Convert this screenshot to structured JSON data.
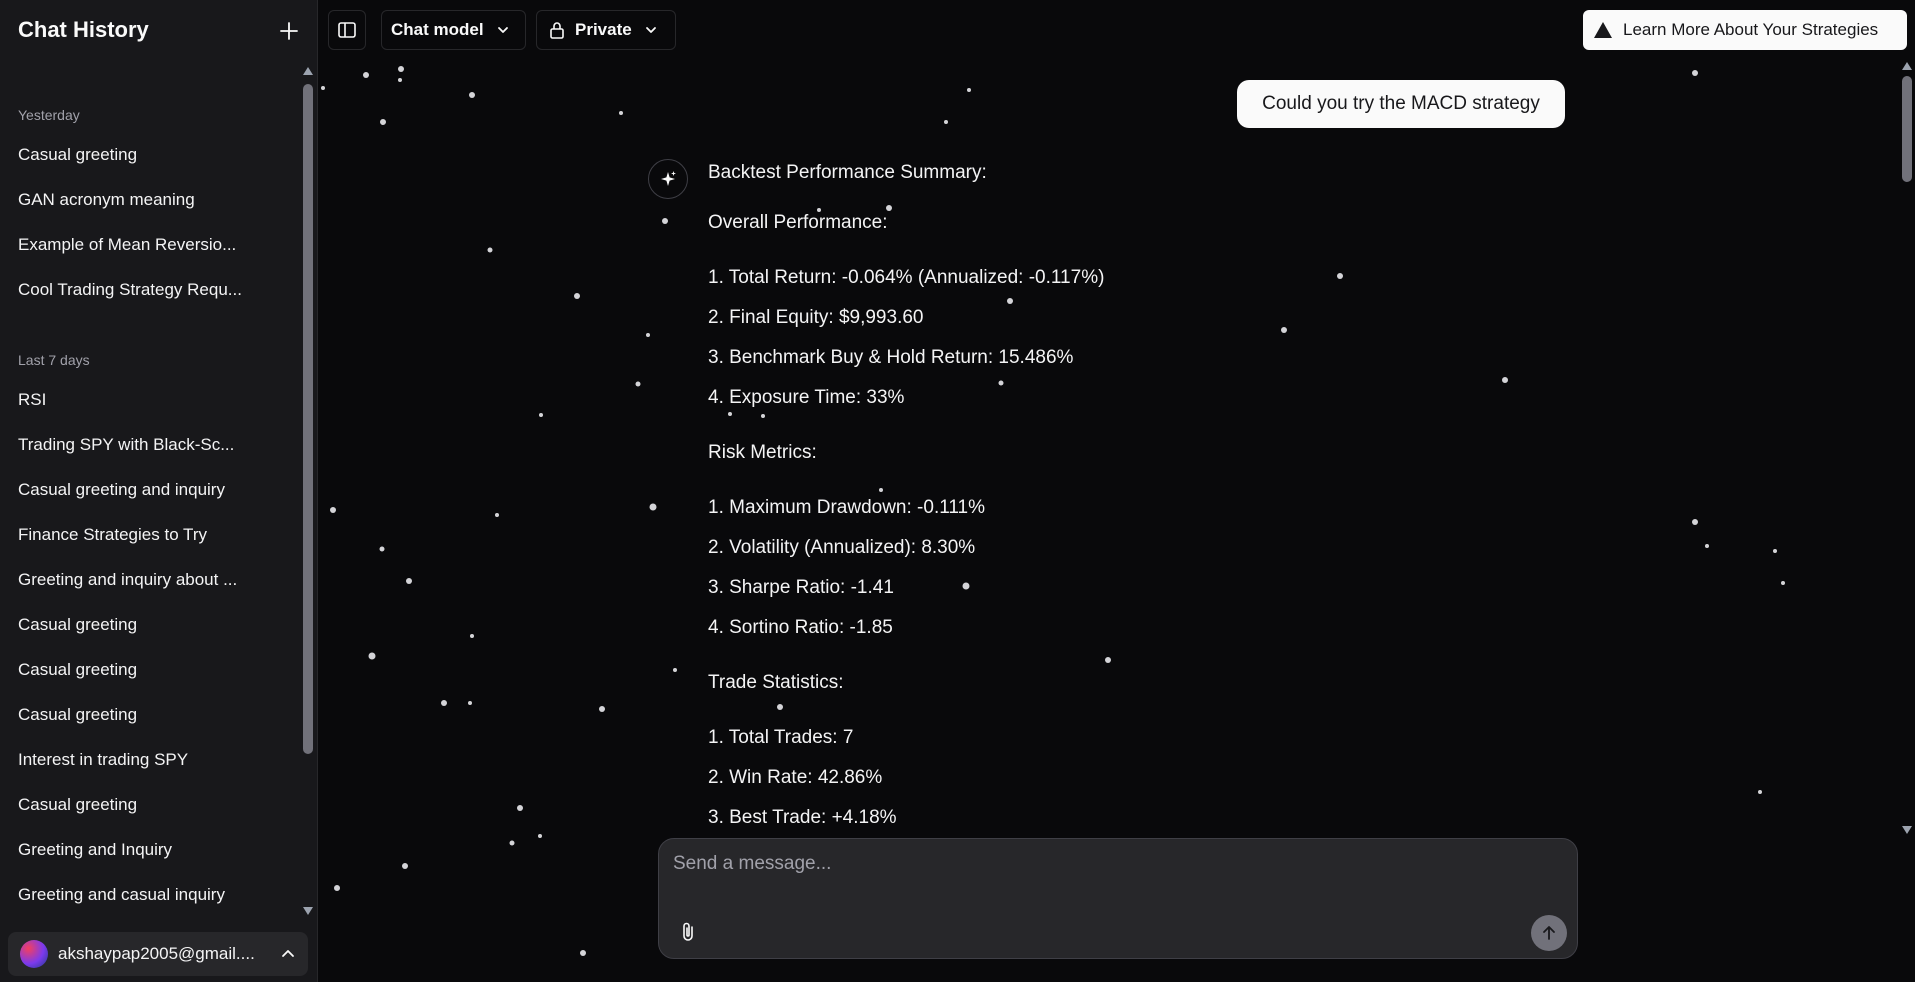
{
  "sidebar": {
    "title": "Chat History",
    "sections": [
      {
        "label": "Yesterday",
        "items": [
          {
            "label": "Casual greeting"
          },
          {
            "label": "GAN acronym meaning"
          },
          {
            "label": "Example of Mean Reversio..."
          },
          {
            "label": "Cool Trading Strategy Requ..."
          }
        ]
      },
      {
        "label": "Last 7 days",
        "items": [
          {
            "label": "RSI"
          },
          {
            "label": "Trading SPY with Black-Sc..."
          },
          {
            "label": "Casual greeting and inquiry"
          },
          {
            "label": "Finance Strategies to Try"
          },
          {
            "label": "Greeting and inquiry about ..."
          },
          {
            "label": "Casual greeting"
          },
          {
            "label": "Casual greeting"
          },
          {
            "label": "Casual greeting"
          },
          {
            "label": "Interest in trading SPY"
          },
          {
            "label": "Casual greeting"
          },
          {
            "label": "Greeting and Inquiry"
          },
          {
            "label": "Greeting and casual inquiry"
          }
        ]
      }
    ],
    "user_email": "akshaypap2005@gmail...."
  },
  "topbar": {
    "model_label": "Chat model",
    "visibility_label": "Private",
    "learn_more_label": "Learn More About Your Strategies"
  },
  "conversation": {
    "user_message": "Could you try the MACD strategy",
    "assistant_lines": [
      "Backtest Performance Summary:",
      "Overall Performance:",
      "1. Total Return: -0.064% (Annualized: -0.117%)",
      "2. Final Equity: $9,993.60",
      "3. Benchmark Buy & Hold Return: 15.486%",
      "4. Exposure Time: 33%",
      "Risk Metrics:",
      "1. Maximum Drawdown: -0.111%",
      "2. Volatility (Annualized): 8.30%",
      "3. Sharpe Ratio: -1.41",
      "4. Sortino Ratio: -1.85",
      "Trade Statistics:",
      "1. Total Trades: 7",
      "2. Win Rate: 42.86%",
      "3. Best Trade: +4.18%"
    ]
  },
  "composer": {
    "placeholder": "Send a message..."
  },
  "icons": {
    "new_chat": "plus-icon",
    "sidebar_toggle": "sidebar-toggle-icon",
    "model_chevron": "chevron-down-icon",
    "lock": "lock-icon",
    "triangle": "triangle-icon",
    "assistant": "sparkles-icon",
    "attach": "paperclip-icon",
    "send": "arrow-up-icon",
    "user_menu": "chevron-up-icon"
  },
  "colors": {
    "background": "#09090b",
    "sidebar": "#18181b",
    "accent_light": "#fafafa",
    "muted_text": "#a1a1aa"
  }
}
